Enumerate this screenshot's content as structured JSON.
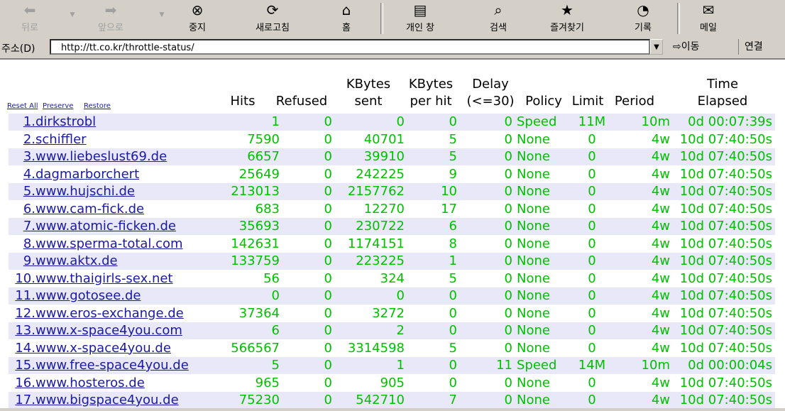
{
  "toolbar": {
    "back": "뒤로",
    "forward": "앞으로",
    "stop": "중지",
    "refresh": "새로고침",
    "home": "홈",
    "personal": "개인 창",
    "search": "검색",
    "favorites": "즐겨찾기",
    "history": "기록",
    "mail": "메일"
  },
  "address": {
    "label": "주소(D)",
    "url": "http://tt.co.kr/throttle-status/",
    "go_label": "이동",
    "links_label": "연결"
  },
  "controls": {
    "reset_all": "Reset All",
    "preserve": "Preserve",
    "restore": "Restore"
  },
  "headers": {
    "hits": "Hits",
    "refused": "Refused",
    "kbytes_sent_1": "KBytes",
    "kbytes_sent_2": "sent",
    "kbytes_per_hit_1": "KBytes",
    "kbytes_per_hit_2": "per hit",
    "delay_1": "Delay",
    "delay_2": "(<=30)",
    "policy": "Policy",
    "limit": "Limit",
    "period": "Period",
    "time_elapsed_1": "Time",
    "time_elapsed_2": "Elapsed"
  },
  "rows": [
    {
      "idx": "1.",
      "site": "dirkstrobl",
      "hits": "1",
      "refused": "0",
      "sent": "0",
      "perhit": "0",
      "delay": "0",
      "policy": "Speed",
      "limit": "11M",
      "period": "10m",
      "elapsed": "0d 00:07:39s"
    },
    {
      "idx": "2.",
      "site": "schiffler",
      "hits": "7590",
      "refused": "0",
      "sent": "40701",
      "perhit": "5",
      "delay": "0",
      "policy": "None",
      "limit": "0",
      "period": "4w",
      "elapsed": "10d 07:40:50s"
    },
    {
      "idx": "3.",
      "site": "www.liebeslust69.de",
      "hits": "6657",
      "refused": "0",
      "sent": "39910",
      "perhit": "5",
      "delay": "0",
      "policy": "None",
      "limit": "0",
      "period": "4w",
      "elapsed": "10d 07:40:50s"
    },
    {
      "idx": "4.",
      "site": "dagmarborchert",
      "hits": "25649",
      "refused": "0",
      "sent": "242225",
      "perhit": "9",
      "delay": "0",
      "policy": "None",
      "limit": "0",
      "period": "4w",
      "elapsed": "10d 07:40:50s"
    },
    {
      "idx": "5.",
      "site": "www.hujschi.de",
      "hits": "213013",
      "refused": "0",
      "sent": "2157762",
      "perhit": "10",
      "delay": "0",
      "policy": "None",
      "limit": "0",
      "period": "4w",
      "elapsed": "10d 07:40:50s"
    },
    {
      "idx": "6.",
      "site": "www.cam-fick.de",
      "hits": "683",
      "refused": "0",
      "sent": "12270",
      "perhit": "17",
      "delay": "0",
      "policy": "None",
      "limit": "0",
      "period": "4w",
      "elapsed": "10d 07:40:50s"
    },
    {
      "idx": "7.",
      "site": "www.atomic-ficken.de",
      "hits": "35693",
      "refused": "0",
      "sent": "230722",
      "perhit": "6",
      "delay": "0",
      "policy": "None",
      "limit": "0",
      "period": "4w",
      "elapsed": "10d 07:40:50s"
    },
    {
      "idx": "8.",
      "site": "www.sperma-total.com",
      "hits": "142631",
      "refused": "0",
      "sent": "1174151",
      "perhit": "8",
      "delay": "0",
      "policy": "None",
      "limit": "0",
      "period": "4w",
      "elapsed": "10d 07:40:50s"
    },
    {
      "idx": "9.",
      "site": "www.aktx.de",
      "hits": "133759",
      "refused": "0",
      "sent": "223225",
      "perhit": "1",
      "delay": "0",
      "policy": "None",
      "limit": "0",
      "period": "4w",
      "elapsed": "10d 07:40:50s"
    },
    {
      "idx": "10.",
      "site": "www.thaigirls-sex.net",
      "hits": "56",
      "refused": "0",
      "sent": "324",
      "perhit": "5",
      "delay": "0",
      "policy": "None",
      "limit": "0",
      "period": "4w",
      "elapsed": "10d 07:40:50s"
    },
    {
      "idx": "11.",
      "site": "www.gotosee.de",
      "hits": "0",
      "refused": "0",
      "sent": "0",
      "perhit": "0",
      "delay": "0",
      "policy": "None",
      "limit": "0",
      "period": "4w",
      "elapsed": "10d 07:40:50s"
    },
    {
      "idx": "12.",
      "site": "www.eros-exchange.de",
      "hits": "37364",
      "refused": "0",
      "sent": "3272",
      "perhit": "0",
      "delay": "0",
      "policy": "None",
      "limit": "0",
      "period": "4w",
      "elapsed": "10d 07:40:50s"
    },
    {
      "idx": "13.",
      "site": "www.x-space4you.com",
      "hits": "6",
      "refused": "0",
      "sent": "2",
      "perhit": "0",
      "delay": "0",
      "policy": "None",
      "limit": "0",
      "period": "4w",
      "elapsed": "10d 07:40:50s"
    },
    {
      "idx": "14.",
      "site": "www.x-space4you.de",
      "hits": "566567",
      "refused": "0",
      "sent": "3314598",
      "perhit": "5",
      "delay": "0",
      "policy": "None",
      "limit": "0",
      "period": "4w",
      "elapsed": "10d 07:40:50s"
    },
    {
      "idx": "15.",
      "site": "www.free-space4you.de",
      "hits": "5",
      "refused": "0",
      "sent": "1",
      "perhit": "0",
      "delay": "11",
      "policy": "Speed",
      "limit": "14M",
      "period": "10m",
      "elapsed": "0d 00:00:04s"
    },
    {
      "idx": "16.",
      "site": "www.hosteros.de",
      "hits": "965",
      "refused": "0",
      "sent": "905",
      "perhit": "0",
      "delay": "0",
      "policy": "None",
      "limit": "0",
      "period": "4w",
      "elapsed": "10d 07:40:50s"
    },
    {
      "idx": "17.",
      "site": "www.bigspace4you.de",
      "hits": "75230",
      "refused": "0",
      "sent": "542710",
      "perhit": "7",
      "delay": "0",
      "policy": "None",
      "limit": "0",
      "period": "4w",
      "elapsed": "10d 07:40:50s"
    }
  ]
}
